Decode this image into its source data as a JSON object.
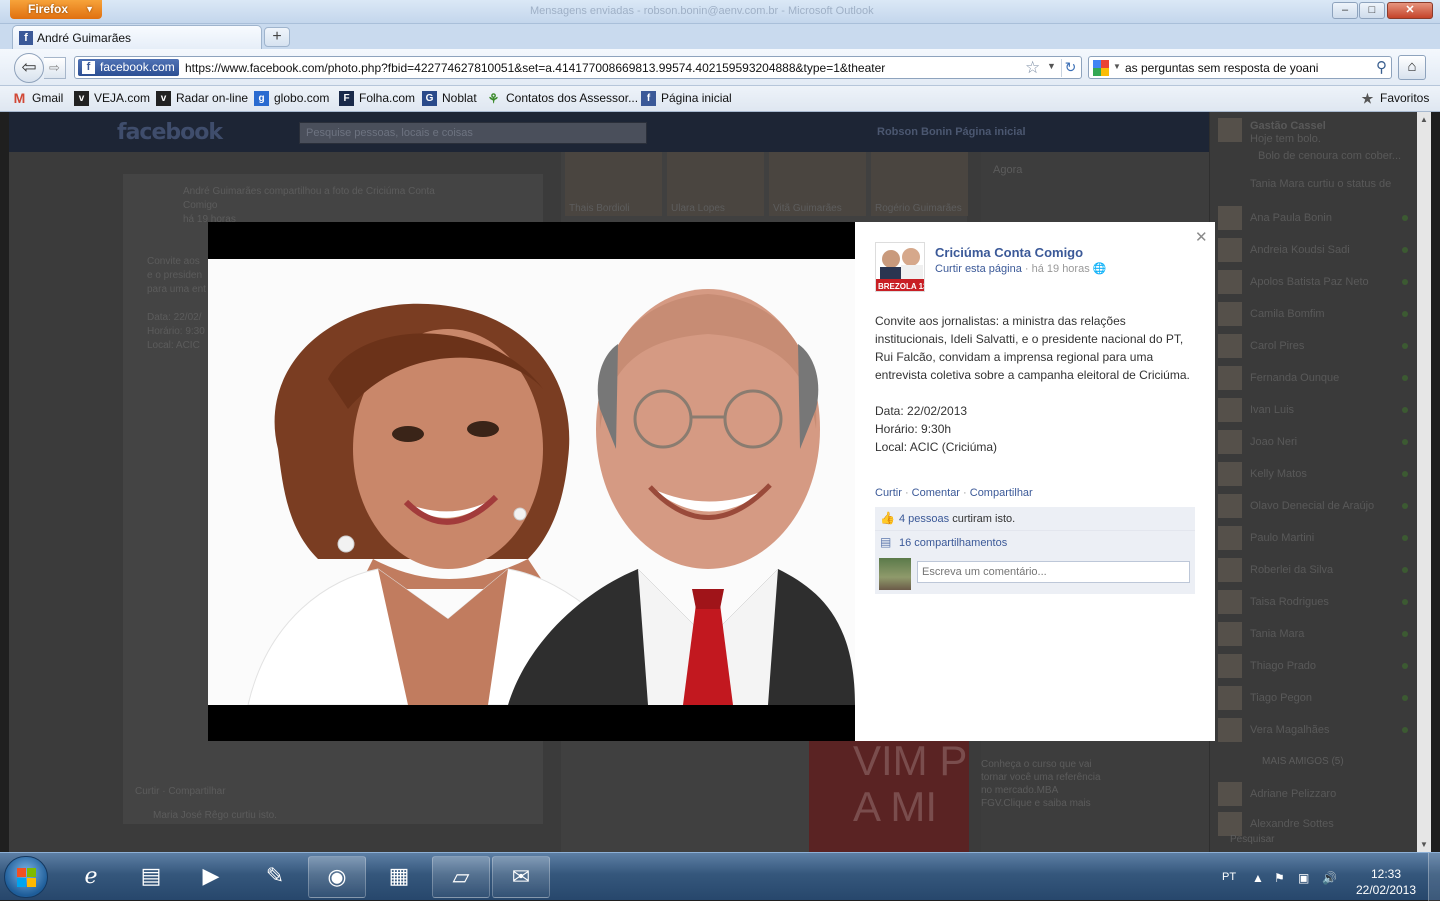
{
  "browser": {
    "app_button": "Firefox",
    "window_title": "Mensagens enviadas - robson.bonin@aenv.com.br - Microsoft Outlook",
    "tab": {
      "title": "André Guimarães",
      "new_tab": "+"
    },
    "url": {
      "site_identity": "facebook.com",
      "address": "https://www.facebook.com/photo.php?fbid=422774627810051&set=a.414177008669813.99574.402159593204888&type=1&theater"
    },
    "search": {
      "query": "as perguntas sem resposta de yoani"
    },
    "bookmarks": [
      "Gmail",
      "VEJA.com",
      "Radar on-line",
      "globo.com",
      "Folha.com",
      "Noblat",
      "Contatos dos Assessor...",
      "Página inicial"
    ],
    "favorites_label": "Favoritos"
  },
  "facebook_bg": {
    "logo": "facebook",
    "search_placeholder": "Pesquise pessoas, locais e coisas",
    "user": "Robson Bonin  Página inicial",
    "feed_author": "André Guimarães compartilhou a foto de Criciúma Conta",
    "feed_author2": "Comigo",
    "feed_time": "há 19 horas",
    "feed_snippets": [
      "Convite aos",
      "e o presiden",
      "para uma ent",
      "Data: 22/02/",
      "Horário: 9:30",
      "Local: ACIC"
    ],
    "feed_actions": "Curtir · Compartilhar",
    "feed_like": "Maria José Rêgo curtiu isto.",
    "friends": [
      "Thais Bordioli",
      "Ulara Lopes",
      "Vitã Guimarães",
      "Rogério Guimarães"
    ],
    "ticker_label": "Agora",
    "ad_words": [
      "VIM P",
      "A MI"
    ],
    "ad_text": "Conheça o curso que vai tornar você uma referência no mercado.MBA FGV.Clique e saiba mais"
  },
  "chat": {
    "top": [
      {
        "name": "Gastão Cassel",
        "status": "Hoje tem bolo.",
        "extra": "Bolo de cenoura com cober..."
      },
      {
        "name": "Tania Mara curtiu o status de"
      }
    ],
    "friends": [
      "Ana Paula Bonin",
      "Andreia Koudsi Sadi",
      "Apolos Batista Paz Neto",
      "Camila Bomfim",
      "Carol Pires",
      "Fernanda Ounque",
      "Ivan Luis",
      "Joao Neri",
      "Kelly Matos",
      "Olavo Denecial de Araújo",
      "Paulo Martini",
      "Roberlei da Silva",
      "Taisa Rodrigues",
      "Tania Mara",
      "Thiago Prado",
      "Tiago Pegon",
      "Vera Magalhães"
    ],
    "more_label": "MAIS AMIGOS (5)",
    "more_friends": [
      "Adriane Pelizzaro",
      "Alexandre Sottes"
    ],
    "search_label": "Pesquisar"
  },
  "theater": {
    "page_name": "Criciúma Conta Comigo",
    "avatar_label": "BREZOLA 13",
    "like_page": "Curtir esta página",
    "time": "há 19 horas",
    "post_paragraph": "Convite aos jornalistas: a ministra das relações institucionais, Ideli Salvatti, e o presidente nacional do PT, Rui Falcão, convidam a imprensa regional para uma entrevista coletiva sobre a campanha eleitoral de Criciúma.",
    "date_line": "Data: 22/02/2013",
    "time_line": "Horário: 9:30h",
    "place_line": "Local: ACIC (Criciúma)",
    "actions": {
      "like": "Curtir",
      "comment": "Comentar",
      "share": "Compartilhar"
    },
    "likes_link": "4 pessoas",
    "likes_suffix": "curtiram isto.",
    "shares": "16 compartilhamentos",
    "comment_placeholder": "Escreva um comentário..."
  },
  "taskbar": {
    "language": "PT",
    "time": "12:33",
    "date": "22/02/2013"
  }
}
